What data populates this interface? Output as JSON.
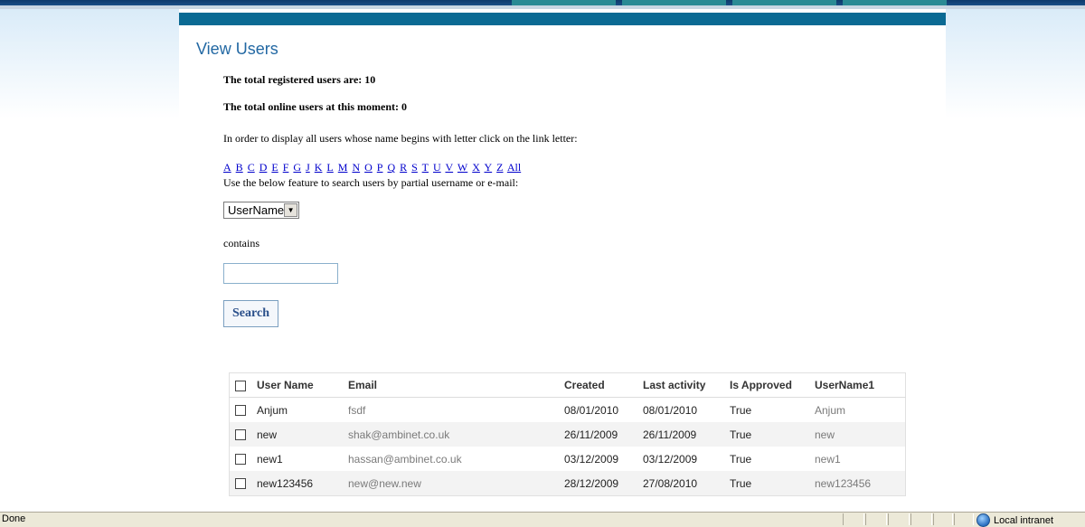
{
  "page": {
    "title": "View Users",
    "total_registered": "The total registered users are: 10",
    "total_online": "The total online users at this moment: 0",
    "letter_instruction": "In order to display all users whose name begins with letter click on the link letter:",
    "letters": [
      "A",
      "B",
      "C",
      "D",
      "E",
      "F",
      "G",
      "J",
      "K",
      "L",
      "M",
      "N",
      "O",
      "P",
      "Q",
      "R",
      "S",
      "T",
      "U",
      "V",
      "W",
      "X",
      "Y",
      "Z",
      "All"
    ],
    "search_instruction": "Use the below feature to search users by partial username or e-mail:",
    "search_field_select": "UserName",
    "contains_label": "contains",
    "search_input_value": "",
    "search_button": "Search"
  },
  "grid": {
    "headers": [
      "User Name",
      "Email",
      "Created",
      "Last activity",
      "Is Approved",
      "UserName1"
    ],
    "rows": [
      {
        "username": "Anjum",
        "email": "fsdf",
        "created": "08/01/2010",
        "last_activity": "08/01/2010",
        "approved": "True",
        "username1": "Anjum"
      },
      {
        "username": "new",
        "email": "shak@ambinet.co.uk",
        "created": "26/11/2009",
        "last_activity": "26/11/2009",
        "approved": "True",
        "username1": "new"
      },
      {
        "username": "new1",
        "email": "hassan@ambinet.co.uk",
        "created": "03/12/2009",
        "last_activity": "03/12/2009",
        "approved": "True",
        "username1": "new1"
      },
      {
        "username": "new123456",
        "email": "new@new.new",
        "created": "28/12/2009",
        "last_activity": "27/08/2010",
        "approved": "True",
        "username1": "new123456"
      }
    ]
  },
  "statusbar": {
    "status": "Done",
    "zone": "Local intranet"
  },
  "colors": {
    "title": "#2268a3",
    "link": "#0000cc",
    "band": "#0b6a93"
  }
}
